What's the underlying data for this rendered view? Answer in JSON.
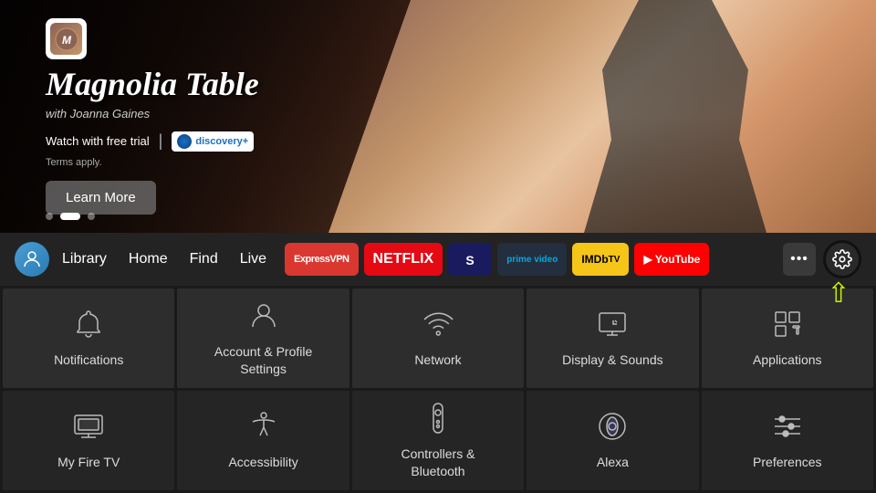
{
  "hero": {
    "badge_label": "M",
    "show_title": "Magnolia Table",
    "show_subtitle": "with Joanna Gaines",
    "watch_text": "Watch with free trial",
    "discovery_text": "discovery+",
    "terms_text": "Terms apply.",
    "learn_more_label": "Learn More",
    "dots": [
      {
        "active": false
      },
      {
        "active": true
      },
      {
        "active": false
      }
    ]
  },
  "nav": {
    "links": [
      {
        "label": "Library"
      },
      {
        "label": "Home"
      },
      {
        "label": "Find"
      },
      {
        "label": "Live"
      }
    ],
    "apps": [
      {
        "label": "ExpressVPN",
        "key": "expressvpn"
      },
      {
        "label": "NETFLIX",
        "key": "netflix"
      },
      {
        "label": "★",
        "key": "starz"
      },
      {
        "label": "prime video",
        "key": "prime"
      },
      {
        "label": "IMDbTV",
        "key": "imdb"
      },
      {
        "label": "▶ YouTube",
        "key": "youtube"
      }
    ],
    "more_label": "•••",
    "settings_label": "⚙"
  },
  "settings": {
    "row1": [
      {
        "id": "notifications",
        "label": "Notifications",
        "icon": "bell"
      },
      {
        "id": "account",
        "label": "Account & Profile\nSettings",
        "icon": "person"
      },
      {
        "id": "network",
        "label": "Network",
        "icon": "wifi"
      },
      {
        "id": "display-sounds",
        "label": "Display & Sounds",
        "icon": "display"
      },
      {
        "id": "applications",
        "label": "Applications",
        "icon": "apps"
      }
    ],
    "row2": [
      {
        "id": "device",
        "label": "My Fire TV",
        "icon": "tv"
      },
      {
        "id": "accessibility",
        "label": "Accessibility",
        "icon": "accessibility"
      },
      {
        "id": "controllers",
        "label": "Controllers &\nBluetooth",
        "icon": "remote"
      },
      {
        "id": "alexa",
        "label": "Alexa",
        "icon": "alexa"
      },
      {
        "id": "preferences",
        "label": "Preferences",
        "icon": "sliders"
      }
    ]
  },
  "arrow": {
    "color": "#c8f000"
  }
}
